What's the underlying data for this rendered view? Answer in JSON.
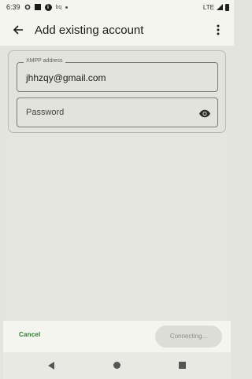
{
  "status_bar": {
    "time": "6:39",
    "small_text": "bq",
    "network": "LTE",
    "icons": [
      "gear-icon",
      "square-icon",
      "info-icon",
      "dot-icon",
      "signal-icon",
      "battery-icon"
    ]
  },
  "app_bar": {
    "title": "Add existing account",
    "back_icon": "arrow-left-icon",
    "menu_icon": "more-vert-icon"
  },
  "form": {
    "xmpp_label": "XMPP address",
    "xmpp_value": "jhhzqy@gmail.com",
    "password_placeholder": "Password",
    "password_toggle_icon": "eye-icon"
  },
  "actions": {
    "cancel_label": "Cancel",
    "connect_label": "Connecting..."
  },
  "nav": {
    "icons": [
      "back-icon",
      "home-icon",
      "recents-icon"
    ]
  },
  "colors": {
    "accent": "#2a7a2a",
    "background": "#e3e4dd",
    "bar": "#f4f5ef"
  }
}
